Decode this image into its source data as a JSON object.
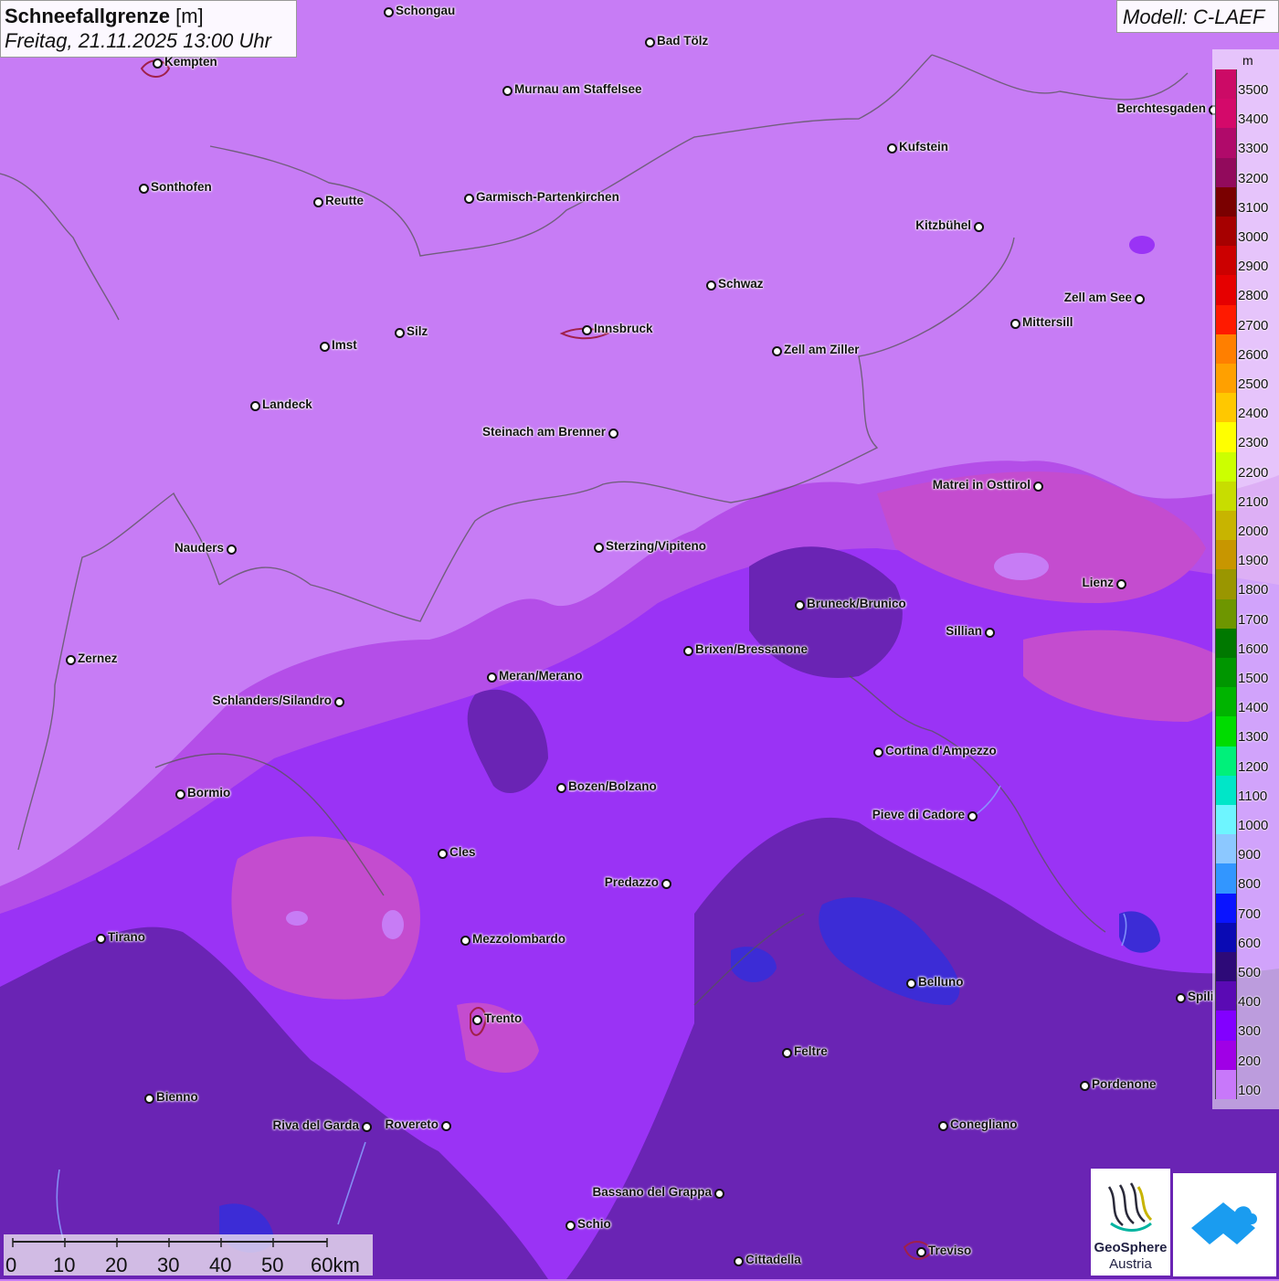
{
  "title": {
    "label": "Schneefallgrenze",
    "unit": "[m]",
    "datetime": "Freitag, 21.11.2025 13:00 Uhr"
  },
  "model": "Modell: C-LAEF",
  "legend": {
    "unit": "m",
    "classes": [
      {
        "label": "3500",
        "color": "#cc0a66"
      },
      {
        "label": "3400",
        "color": "#d4096a"
      },
      {
        "label": "3300",
        "color": "#b00a6a"
      },
      {
        "label": "3200",
        "color": "#920a5c"
      },
      {
        "label": "3100",
        "color": "#7a0000"
      },
      {
        "label": "3000",
        "color": "#a60000"
      },
      {
        "label": "2900",
        "color": "#cc0000"
      },
      {
        "label": "2800",
        "color": "#e60000"
      },
      {
        "label": "2700",
        "color": "#ff1a00"
      },
      {
        "label": "2600",
        "color": "#ff7f00"
      },
      {
        "label": "2500",
        "color": "#ffa000"
      },
      {
        "label": "2400",
        "color": "#ffc800"
      },
      {
        "label": "2300",
        "color": "#ffff00"
      },
      {
        "label": "2200",
        "color": "#ccff00"
      },
      {
        "label": "2100",
        "color": "#c8dd00"
      },
      {
        "label": "2000",
        "color": "#c8b400"
      },
      {
        "label": "1900",
        "color": "#c89600"
      },
      {
        "label": "1800",
        "color": "#9a9600"
      },
      {
        "label": "1700",
        "color": "#6e9600"
      },
      {
        "label": "1600",
        "color": "#007800"
      },
      {
        "label": "1500",
        "color": "#009600"
      },
      {
        "label": "1400",
        "color": "#00b400"
      },
      {
        "label": "1300",
        "color": "#00dc00"
      },
      {
        "label": "1200",
        "color": "#00f07a"
      },
      {
        "label": "1100",
        "color": "#00e6c8"
      },
      {
        "label": "1000",
        "color": "#6ef5ff"
      },
      {
        "label": "900",
        "color": "#8cc8ff"
      },
      {
        "label": "800",
        "color": "#3296ff"
      },
      {
        "label": "700",
        "color": "#0a14ff"
      },
      {
        "label": "600",
        "color": "#0a0ab4"
      },
      {
        "label": "500",
        "color": "#2d0a78"
      },
      {
        "label": "400",
        "color": "#5a0ab4"
      },
      {
        "label": "300",
        "color": "#8200ff"
      },
      {
        "label": "200",
        "color": "#a000e6"
      },
      {
        "label": "100",
        "color": "#c878fa"
      }
    ]
  },
  "cities": [
    {
      "name": "Schongau"
    },
    {
      "name": "Bad Tölz"
    },
    {
      "name": "Kempten"
    },
    {
      "name": "Murnau am Staffelsee"
    },
    {
      "name": "Berchtesgaden"
    },
    {
      "name": "Kufstein"
    },
    {
      "name": "Sonthofen"
    },
    {
      "name": "Reutte"
    },
    {
      "name": "Garmisch-Partenkirchen"
    },
    {
      "name": "Kitzbühel"
    },
    {
      "name": "Schwaz"
    },
    {
      "name": "Zell am See"
    },
    {
      "name": "Mittersill"
    },
    {
      "name": "Imst"
    },
    {
      "name": "Silz"
    },
    {
      "name": "Innsbruck"
    },
    {
      "name": "Zell am Ziller"
    },
    {
      "name": "Landeck"
    },
    {
      "name": "Steinach am Brenner"
    },
    {
      "name": "Matrei in Osttirol"
    },
    {
      "name": "Nauders"
    },
    {
      "name": "Sterzing/Vipiteno"
    },
    {
      "name": "Lienz"
    },
    {
      "name": "Bruneck/Brunico"
    },
    {
      "name": "Sillian"
    },
    {
      "name": "Zernez"
    },
    {
      "name": "Brixen/Bressanone"
    },
    {
      "name": "Meran/Merano"
    },
    {
      "name": "Schlanders/Silandro"
    },
    {
      "name": "Cortina d'Ampezzo"
    },
    {
      "name": "Bozen/Bolzano"
    },
    {
      "name": "Bormio"
    },
    {
      "name": "Pieve di Cadore"
    },
    {
      "name": "Cles"
    },
    {
      "name": "Predazzo"
    },
    {
      "name": "Tirano"
    },
    {
      "name": "Mezzolombardo"
    },
    {
      "name": "Belluno"
    },
    {
      "name": "Spili"
    },
    {
      "name": "Trento"
    },
    {
      "name": "Feltre"
    },
    {
      "name": "Pordenone"
    },
    {
      "name": "Bienno"
    },
    {
      "name": "Riva del Garda"
    },
    {
      "name": "Rovereto"
    },
    {
      "name": "Conegliano"
    },
    {
      "name": "Bassano del Grappa"
    },
    {
      "name": "Schio"
    },
    {
      "name": "Treviso"
    },
    {
      "name": "Cittadella"
    }
  ],
  "scale": {
    "ticks": [
      "0",
      "10",
      "20",
      "30",
      "40",
      "50",
      "60km"
    ]
  },
  "logo": {
    "name1": "GeoSphere",
    "name2": "Austria"
  }
}
